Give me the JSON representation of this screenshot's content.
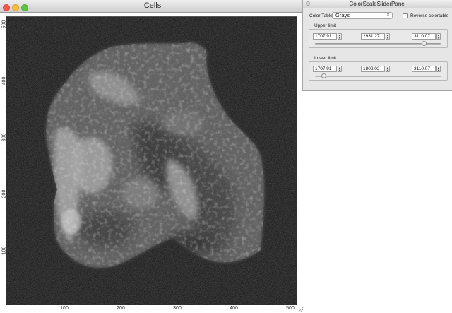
{
  "window": {
    "title": "Cells"
  },
  "axes": {
    "x_ticks": [
      "100",
      "200",
      "300",
      "400",
      "500"
    ],
    "y_ticks": [
      "100",
      "200",
      "300",
      "400",
      "500"
    ],
    "range": [
      0,
      512
    ]
  },
  "panel": {
    "title": "ColorScaleSliderPanel",
    "color_table_label": "Color Table:",
    "color_table_value": "Grays",
    "reverse_label": "Reverse colortable",
    "reverse_checked": false,
    "upper": {
      "label": "Upper limit",
      "min": "1707.91",
      "value": "2931.27",
      "max": "3110.07",
      "slider_fraction": 0.87
    },
    "lower": {
      "label": "Lower limit",
      "min": "1707.91",
      "value": "1802.02",
      "max": "3110.07",
      "slider_fraction": 0.07
    }
  }
}
